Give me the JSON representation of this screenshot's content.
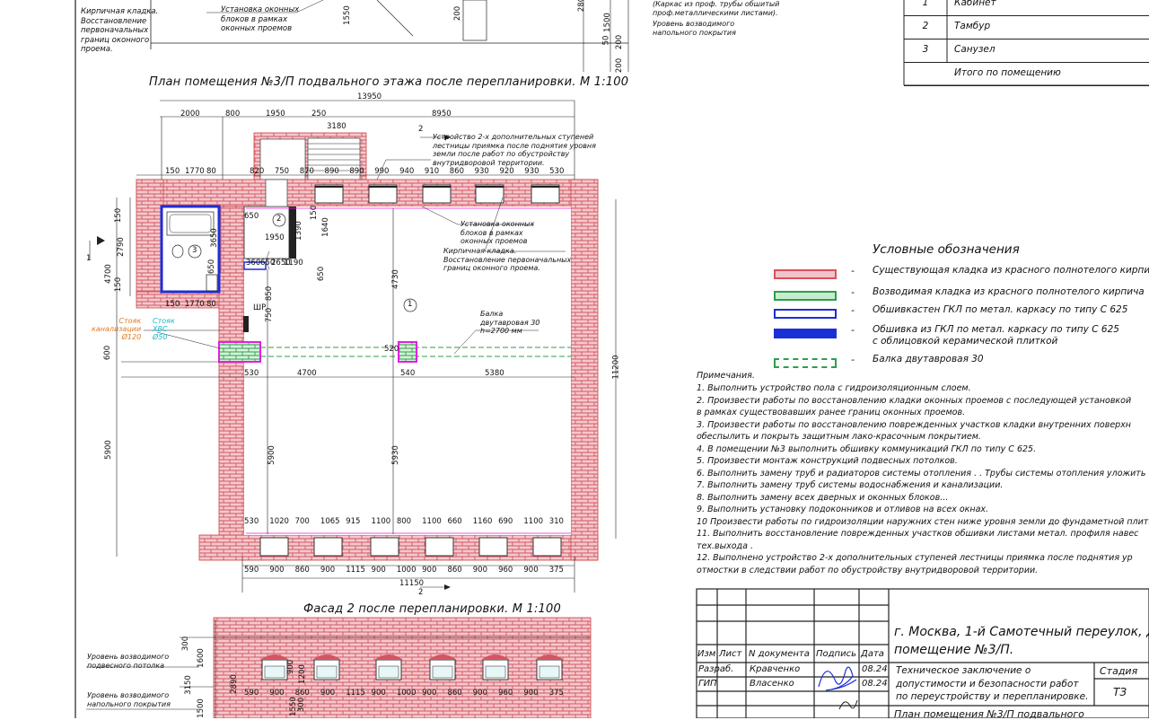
{
  "plan": {
    "title": "План помещения №3/П подвального этажа после перепланировки. М 1:100",
    "top_notes": {
      "brick_left": [
        "Кирпичная кладка.",
        "Восстановление",
        "первоначальных",
        "границ оконного",
        "проема."
      ],
      "window_left": [
        "Установка оконных",
        "блоков в рамках",
        "оконных проемов"
      ],
      "frame_right": [
        "(Каркас из проф. трубы обшитый",
        "проф.металлическими листами)."
      ],
      "floor_level": [
        "Уровень возводимого",
        "напольного покрытия"
      ],
      "dims_top": [
        "1550",
        "200",
        "200",
        "1500",
        "200",
        "280",
        "50"
      ]
    },
    "overall_dims": {
      "total": "13950",
      "top_row1": [
        "2000",
        "800",
        "1950",
        "250",
        "8950"
      ],
      "stair": "3180",
      "top_row2_left": [
        "150",
        "1770",
        "80"
      ],
      "top_row2_right": [
        "820",
        "750",
        "870",
        "890",
        "890",
        "990",
        "940",
        "910",
        "860",
        "930",
        "920",
        "930",
        "530"
      ],
      "left": [
        "150",
        "2790",
        "4700",
        "150",
        "600",
        "5900"
      ],
      "right_total": "11200",
      "bottom_row1": [
        "530",
        "1020",
        "700",
        "1065",
        "915",
        "1100",
        "800",
        "1100",
        "660",
        "1160",
        "690",
        "1100",
        "310"
      ],
      "bottom_row2": [
        "590",
        "900",
        "860",
        "900",
        "1115",
        "900",
        "1000",
        "900",
        "860",
        "900",
        "960",
        "900",
        "375"
      ],
      "bottom_total": "11150",
      "inner": [
        "1640",
        "150",
        "1390",
        "1950",
        "650",
        "650",
        "2650",
        "1190",
        "360",
        "650",
        "850",
        "750",
        "4730",
        "5930",
        "5900",
        "4700",
        "530",
        "540",
        "520",
        "5380",
        "150",
        "1770",
        "80",
        "650",
        "3650"
      ]
    },
    "section_marks": [
      "1",
      "1",
      "2",
      "2"
    ],
    "room_marks": [
      "1",
      "2",
      "3"
    ],
    "labels": {
      "stair_note": [
        "Устройство 2-х дополнительных ступеней",
        "лестницы приямка после поднятия уровня",
        "земли после работ по обустройству",
        "внутридворовой территории."
      ],
      "window_note": [
        "Установка оконных",
        "блоков в рамках",
        "оконных проемов"
      ],
      "brick_note": [
        "Кирпичная кладка.",
        "Восстановление первоначальных",
        "границ оконного проема."
      ],
      "beam_note": [
        "Балка",
        "двутавровая 30",
        "h=2700 мм"
      ],
      "sewer": [
        "Стояк",
        "канализации",
        "Ø120"
      ],
      "water": [
        "Стояк",
        "ХВС",
        "Ø50"
      ],
      "shr": "ШР"
    }
  },
  "facade": {
    "title": "Фасад 2 после перепланировки. М 1:100",
    "labels": [
      "Уровень возводимого",
      "подвесного потолка",
      "Уровень возводимого",
      "напольного покрытия"
    ],
    "dims_left": [
      "300",
      "1600",
      "3150",
      "2890",
      "1500"
    ],
    "dims_bottom": [
      "590",
      "900",
      "860",
      "900",
      "1115",
      "900",
      "1000",
      "900",
      "860",
      "900",
      "960",
      "900",
      "375"
    ],
    "dims_small": [
      "900",
      "1200",
      "1550",
      "300"
    ]
  },
  "rooms_table": {
    "rows": [
      {
        "num": "1",
        "name": "Кабинет"
      },
      {
        "num": "2",
        "name": "Тамбур"
      },
      {
        "num": "3",
        "name": "Санузел"
      },
      {
        "num": "",
        "name": "Итого по помещению"
      }
    ]
  },
  "legend": {
    "title": "Условные обозначения",
    "dash": "-",
    "items": [
      {
        "text": [
          "Существующая кладка из красного полнотелого кирпича"
        ],
        "color": "#d8525c",
        "fill": "#f0c4c8"
      },
      {
        "text": [
          "Возводимая кладка из красного полнотелого кирпича"
        ],
        "color": "#2e9e4a",
        "fill": "#c8ecd0"
      },
      {
        "text": [
          "Обшивкастен ГКЛ по метал. каркасу по типу С 625"
        ],
        "color": "#1c2fd6",
        "fill": "#ffffff"
      },
      {
        "text": [
          "Обшивка из ГКЛ по метал. каркасу по типу С 625",
          "с облицовкой керамической плиткой"
        ],
        "color": "#1c2fd6",
        "fill": "#1c2fd6"
      },
      {
        "text": [
          "Балка двутавровая 30"
        ],
        "color": "#2e9e4a",
        "fill": "#ffffff"
      }
    ]
  },
  "notes": {
    "heading": "Примечания.",
    "lines": [
      "1. Выполнить устройство пола с гидроизоляционным слоем.",
      "2. Произвести работы по восстановлению кладки оконных проемов с последующей установкой",
      "в рамках существовавших ранее границ оконных проемов.",
      "3. Произвести работы по восстановлению поврежденных участков кладки внутренних поверхн",
      "обеспылить и покрыть защитным лако-красочным покрытием.",
      "4. В помещении №3 выполнить обшивку коммуникаций ГКЛ по типу С 625.",
      "5. Произвести монтаж конструкций подвесных потолков.",
      "6. Выполнить замену труб и радиаторов системы отопления .      . Трубы системы отопления уложить",
      "7. Выполнить замену труб системы водоснабжения и канализации.",
      "8. Выполнить замену всех дверных и оконных блоков...",
      "9. Выполнить установку подоконников и отливов на всех окнах.",
      "10 Произвести работы по гидроизоляции наружних стен ниже уровня земли до фундаметной плиты.",
      "11. Выполнить   восстановление поврежденных участков обшивки листами метал. профиля навес",
      "тех.выхода .",
      "12. Выполнено устройство 2-х дополнительных ступеней лестницы приямка после поднятия ур",
      "отмостки в следствии работ по обустройству внутридворовой территории."
    ]
  },
  "stamp": {
    "header": [
      "Изм",
      "Лист",
      "N документа",
      "Подпись",
      "Дата"
    ],
    "rows": [
      {
        "role": "Разраб.",
        "name": "Кравченко",
        "date": "08.24"
      },
      {
        "role": "ГИП",
        "name": "Власенко",
        "date": "08.24"
      }
    ],
    "address": [
      "г. Москва, 1-й Самотечный переулок, до",
      "помещение №3/П."
    ],
    "doc_title": [
      "Техническое заключение о",
      "допустимости и безопасности работ",
      "по переустройству и перепланировке."
    ],
    "stage_label": "Стадия",
    "stage": "ТЗ",
    "sheet_title": "План помещения №3/П подвального"
  }
}
